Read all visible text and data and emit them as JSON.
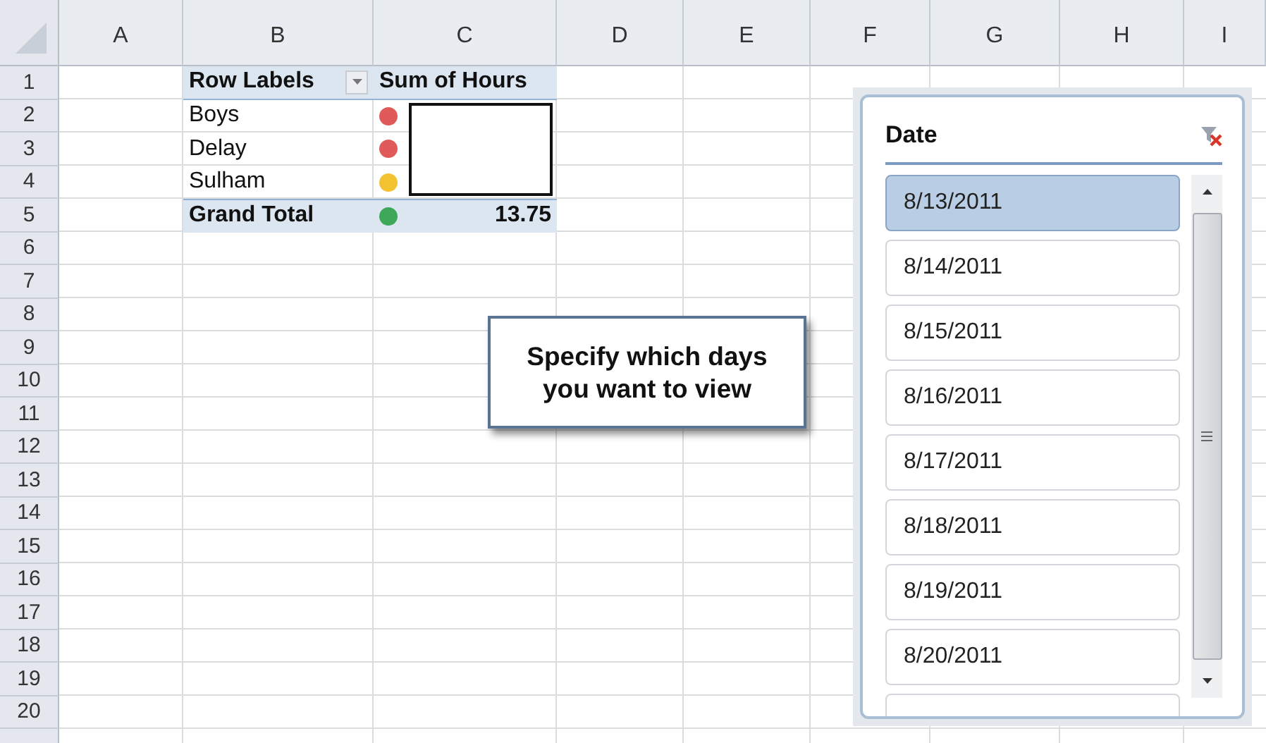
{
  "columns": [
    "A",
    "B",
    "C",
    "D",
    "E",
    "F",
    "G",
    "H",
    "I"
  ],
  "row_numbers": [
    "1",
    "2",
    "3",
    "4",
    "5",
    "6",
    "7",
    "8",
    "9",
    "10",
    "11",
    "12",
    "13",
    "14",
    "15",
    "16",
    "17",
    "18",
    "19",
    "20"
  ],
  "pivot": {
    "row_labels_header": "Row Labels",
    "value_header": "Sum of Hours",
    "rows": [
      {
        "label": "Boys",
        "color": "#e05a5a"
      },
      {
        "label": "Delay",
        "color": "#e05a5a"
      },
      {
        "label": "Sulham",
        "color": "#f2c230"
      }
    ],
    "total": {
      "label": "Grand Total",
      "value": "13.75",
      "color": "#3da85a"
    }
  },
  "callout": {
    "text": "Specify which days you want to view"
  },
  "slicer": {
    "title": "Date",
    "items": [
      {
        "label": "8/13/2011",
        "selected": true
      },
      {
        "label": "8/14/2011",
        "selected": false
      },
      {
        "label": "8/15/2011",
        "selected": false
      },
      {
        "label": "8/16/2011",
        "selected": false
      },
      {
        "label": "8/17/2011",
        "selected": false
      },
      {
        "label": "8/18/2011",
        "selected": false
      },
      {
        "label": "8/19/2011",
        "selected": false
      },
      {
        "label": "8/20/2011",
        "selected": false
      }
    ]
  }
}
